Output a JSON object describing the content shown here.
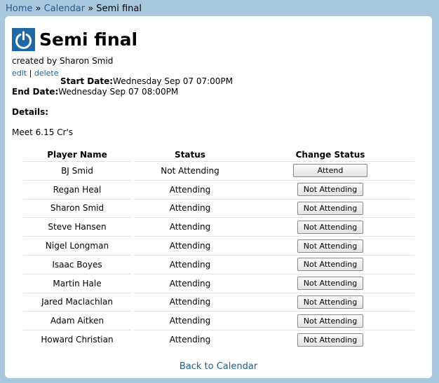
{
  "breadcrumb": {
    "home": "Home",
    "sep1": " » ",
    "calendar": "Calendar",
    "sep2": " » ",
    "current": "Semi final"
  },
  "event": {
    "title": "Semi final",
    "created_by": "created by Sharon Smid",
    "edit": "edit",
    "action_sep": "|",
    "delete": "delete",
    "start_label": "Start Date:",
    "start_value": "Wednesday Sep 07 07:00PM",
    "end_label": "End Date:",
    "end_value": "Wednesday Sep 07 08:00PM",
    "details_label": "Details:",
    "details_text": "Meet 6.15 Cr's"
  },
  "table": {
    "headers": [
      "Player Name",
      "Status",
      "Change Status"
    ],
    "rows": [
      {
        "name": "BJ Smid",
        "status": "Not Attending",
        "action": "Attend"
      },
      {
        "name": "Regan Heal",
        "status": "Attending",
        "action": "Not Attending"
      },
      {
        "name": "Sharon Smid",
        "status": "Attending",
        "action": "Not Attending"
      },
      {
        "name": "Steve Hansen",
        "status": "Attending",
        "action": "Not Attending"
      },
      {
        "name": "Nigel Longman",
        "status": "Attending",
        "action": "Not Attending"
      },
      {
        "name": "Isaac Boyes",
        "status": "Attending",
        "action": "Not Attending"
      },
      {
        "name": "Martin Hale",
        "status": "Attending",
        "action": "Not Attending"
      },
      {
        "name": "Jared Maclachlan",
        "status": "Attending",
        "action": "Not Attending"
      },
      {
        "name": "Adam Aitken",
        "status": "Attending",
        "action": "Not Attending"
      },
      {
        "name": "Howard Christian",
        "status": "Attending",
        "action": "Not Attending"
      }
    ]
  },
  "back_link": "Back to Calendar",
  "colors": {
    "background": "#a9c7dd",
    "link": "#1f5f95",
    "logo": "#1d69a8"
  },
  "icons": {
    "logo": "power-icon"
  }
}
